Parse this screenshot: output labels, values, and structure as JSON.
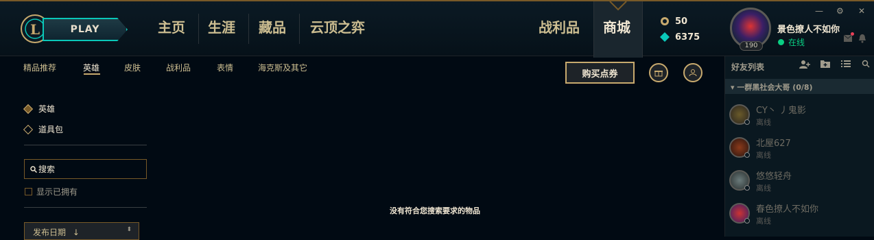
{
  "play_label": "PLAY",
  "nav": [
    "主页",
    "生涯",
    "藏品",
    "云顶之弈"
  ],
  "nav_right": [
    "战利品",
    "商城"
  ],
  "currency": {
    "rp": "50",
    "be": "6375"
  },
  "profile": {
    "name": "景色撩人不如你",
    "status": "在线",
    "level": "190"
  },
  "window": {
    "minimize": "—",
    "settings": "⚙",
    "close": "✕"
  },
  "store_tabs": [
    "精品推荐",
    "英雄",
    "皮肤",
    "战利品",
    "表情",
    "海克斯及其它"
  ],
  "buy_rp_label": "购买点券",
  "filters": {
    "champions": "英雄",
    "bundles": "道具包"
  },
  "search_placeholder": "搜索",
  "show_owned_label": "显示已拥有",
  "sort_label": "发布日期",
  "sort_arrow": "↓",
  "empty_message": "没有符合您搜索要求的物品",
  "friends": {
    "title": "好友列表",
    "group": "一群黑社会大哥 (0/8)",
    "list": [
      {
        "name": "CY丶 丿鬼影",
        "status": "离线"
      },
      {
        "name": "北屋627",
        "status": "离线"
      },
      {
        "name": "悠悠轻舟",
        "status": "离线"
      },
      {
        "name": "春色撩人不如你",
        "status": "离线"
      }
    ]
  },
  "colors": {
    "gold": "#c8aa6e",
    "hextech": "#0ac8b9",
    "online": "#0acf83",
    "bg": "#010a13"
  }
}
